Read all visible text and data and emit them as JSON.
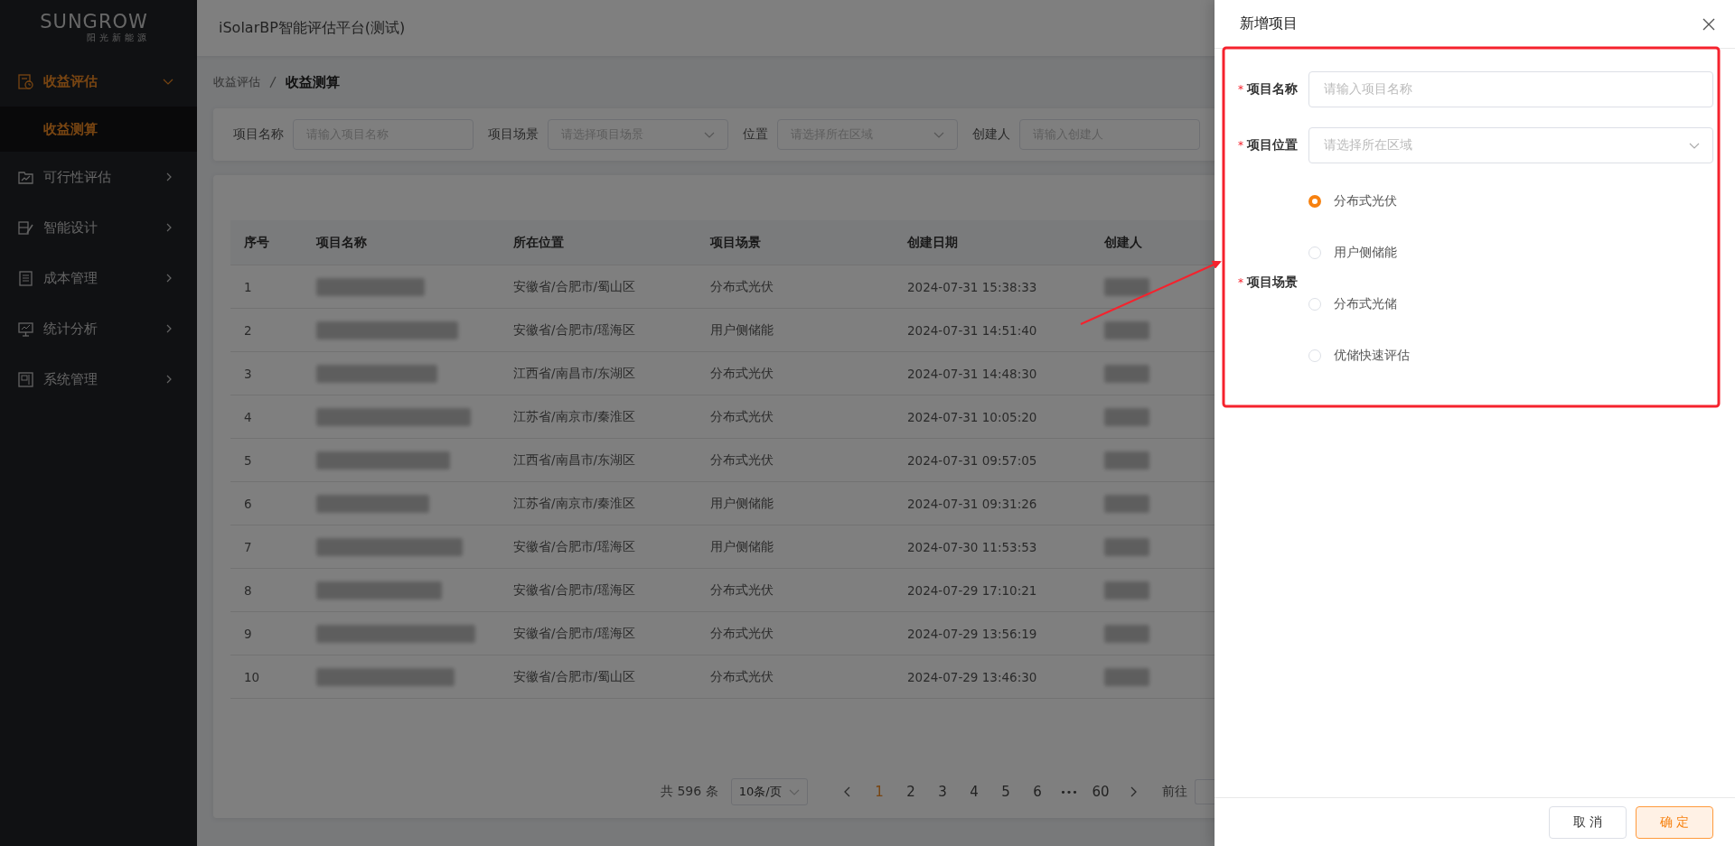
{
  "sidebar": {
    "logo": "SUNGROW",
    "logo_subtitle": "阳光新能源",
    "items": [
      {
        "label": "收益评估",
        "expanded": true,
        "children": [
          {
            "label": "收益测算",
            "selected": true
          }
        ]
      },
      {
        "label": "可行性评估",
        "expanded": false
      },
      {
        "label": "智能设计",
        "expanded": false
      },
      {
        "label": "成本管理",
        "expanded": false
      },
      {
        "label": "统计分析",
        "expanded": false
      },
      {
        "label": "系统管理",
        "expanded": false
      }
    ]
  },
  "header": {
    "title": "iSolarBP智能评估平台(测试)"
  },
  "breadcrumb": [
    "收益评估",
    "收益测算"
  ],
  "filters": [
    {
      "kind": "input",
      "label": "项目名称",
      "placeholder": "请输入项目名称"
    },
    {
      "kind": "select",
      "label": "项目场景",
      "placeholder": "请选择项目场景"
    },
    {
      "kind": "select",
      "label": "位置",
      "placeholder": "请选择所在区域"
    },
    {
      "kind": "input",
      "label": "创建人",
      "placeholder": "请输入创建人"
    }
  ],
  "table": {
    "columns": [
      "序号",
      "项目名称",
      "所在位置",
      "项目场景",
      "创建日期",
      "创建人"
    ],
    "rows": [
      {
        "index": "1",
        "location": "安徽省/合肥市/蜀山区",
        "scene": "分布式光伏",
        "created": "2024-07-31 15:38:33"
      },
      {
        "index": "2",
        "location": "安徽省/合肥市/瑶海区",
        "scene": "用户侧储能",
        "created": "2024-07-31 14:51:40"
      },
      {
        "index": "3",
        "location": "江西省/南昌市/东湖区",
        "scene": "分布式光伏",
        "created": "2024-07-31 14:48:30"
      },
      {
        "index": "4",
        "location": "江苏省/南京市/秦淮区",
        "scene": "分布式光伏",
        "created": "2024-07-31 10:05:20"
      },
      {
        "index": "5",
        "location": "江西省/南昌市/东湖区",
        "scene": "分布式光伏",
        "created": "2024-07-31 09:57:05"
      },
      {
        "index": "6",
        "location": "江苏省/南京市/秦淮区",
        "scene": "用户侧储能",
        "created": "2024-07-31 09:31:26"
      },
      {
        "index": "7",
        "location": "安徽省/合肥市/瑶海区",
        "scene": "用户侧储能",
        "created": "2024-07-30 11:53:53"
      },
      {
        "index": "8",
        "location": "安徽省/合肥市/瑶海区",
        "scene": "分布式光伏",
        "created": "2024-07-29 17:10:21"
      },
      {
        "index": "9",
        "location": "安徽省/合肥市/瑶海区",
        "scene": "分布式光伏",
        "created": "2024-07-29 13:56:19"
      },
      {
        "index": "10",
        "location": "安徽省/合肥市/蜀山区",
        "scene": "分布式光伏",
        "created": "2024-07-29 13:46:30"
      }
    ]
  },
  "pagination": {
    "total": "共 596 条",
    "page_size": "10条/页",
    "pages": [
      {
        "kind": "page",
        "label": "1",
        "selected": true
      },
      {
        "kind": "page",
        "label": "2",
        "selected": false
      },
      {
        "kind": "page",
        "label": "3",
        "selected": false
      },
      {
        "kind": "page",
        "label": "4",
        "selected": false
      },
      {
        "kind": "page",
        "label": "5",
        "selected": false
      },
      {
        "kind": "page",
        "label": "6",
        "selected": false
      },
      {
        "kind": "more",
        "label": "•••",
        "selected": false
      },
      {
        "kind": "page",
        "label": "60",
        "selected": false
      }
    ],
    "goto_label": "前往"
  },
  "drawer": {
    "title": "新增项目",
    "fields": [
      {
        "kind": "input",
        "mark": "*",
        "label": "项目名称",
        "placeholder": "请输入项目名称"
      },
      {
        "kind": "select",
        "mark": "*",
        "label": "项目位置",
        "placeholder": "请选择所在区域"
      },
      {
        "kind": "radio",
        "mark": "*",
        "label": "项目场景",
        "options": [
          {
            "label": "分布式光伏",
            "selected": true
          },
          {
            "label": "用户侧储能",
            "selected": false
          },
          {
            "label": "分布式光储",
            "selected": false
          },
          {
            "label": "优储快速评估",
            "selected": false
          }
        ]
      }
    ],
    "buttons": [
      {
        "kind": "default",
        "label": "取 消"
      },
      {
        "kind": "primary",
        "label": "确 定"
      }
    ]
  }
}
